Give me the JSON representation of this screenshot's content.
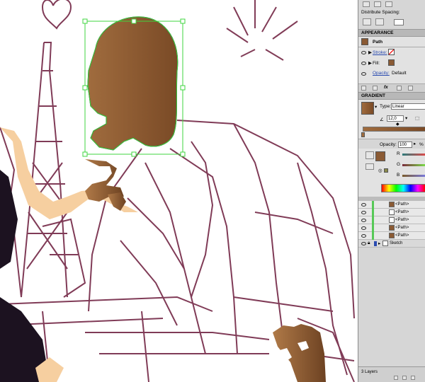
{
  "panels": {
    "align": {
      "distribute_spacing_label": "Distribute Spacing:"
    },
    "appearance": {
      "tab_label": "APPEARANCE",
      "object_label": "Path",
      "stroke_label": "Stroke:",
      "fill_label": "Fill:",
      "opacity_label": "Opacity:",
      "opacity_value": "Default"
    },
    "gradient": {
      "tab_label": "GRADIENT",
      "type_label": "Type:",
      "type_value": "Linear",
      "angle_value": "12,0"
    },
    "transparency": {
      "opacity_label": "Opacity:",
      "opacity_value": "100",
      "percent": "%"
    },
    "color": {
      "r_label": "R",
      "g_label": "G",
      "b_label": "B"
    },
    "layers": {
      "rows": [
        {
          "name": "<Path>"
        },
        {
          "name": "<Path>"
        },
        {
          "name": "<Path>"
        },
        {
          "name": "<Path>"
        },
        {
          "name": "<Path>"
        },
        {
          "name": "Sketch"
        }
      ],
      "status": "3 Layers"
    }
  },
  "colors": {
    "skin_brown": "#8a5a34",
    "sketch_line": "#6b1a3a",
    "selection": "#3fd63f",
    "dress": "#1c1220",
    "skin_light": "#f6cfa0",
    "panel_bg": "#d6d6d6"
  }
}
